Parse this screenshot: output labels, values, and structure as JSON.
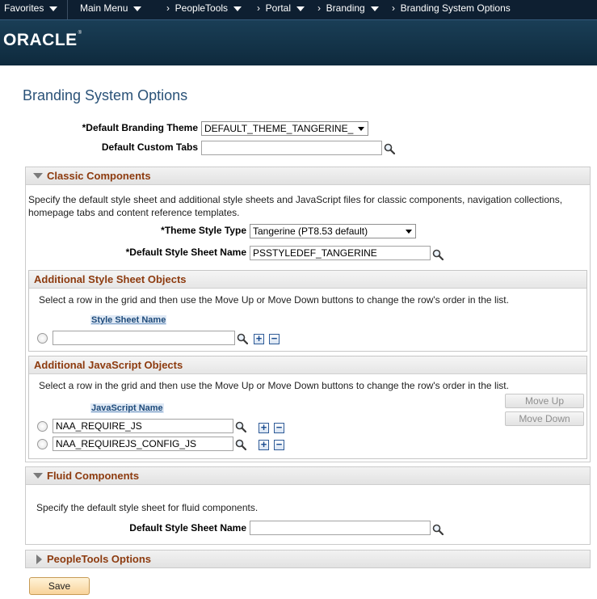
{
  "nav": {
    "favorites": "Favorites",
    "main_menu": "Main Menu",
    "crumbs": [
      "PeopleTools",
      "Portal",
      "Branding",
      "Branding System Options"
    ]
  },
  "logo": "ORACLE",
  "page_title": "Branding System Options",
  "fields": {
    "default_branding_theme_label": "*Default Branding Theme",
    "default_branding_theme_value": "DEFAULT_THEME_TANGERINE_",
    "default_custom_tabs_label": "Default Custom Tabs",
    "default_custom_tabs_value": ""
  },
  "classic": {
    "title": "Classic Components",
    "description_line1": "Specify the default style sheet and additional style sheets and JavaScript files for classic components, navigation collections,",
    "description_line2": "homepage tabs and content reference templates.",
    "theme_style_type_label": "*Theme Style Type",
    "theme_style_type_value": "Tangerine (PT8.53 default)",
    "default_style_sheet_label": "*Default Style Sheet Name",
    "default_style_sheet_value": "PSSTYLEDEF_TANGERINE",
    "style_sheet_objects": {
      "title": "Additional Style Sheet Objects",
      "instructions": "Select a row in the grid and then use the Move Up or Move Down buttons to change the row's order in the list.",
      "column": "Style Sheet Name",
      "rows": [
        ""
      ]
    },
    "js_objects": {
      "title": "Additional JavaScript Objects",
      "instructions": "Select a row in the grid and then use the Move Up or Move Down buttons to change the row's order in the list.",
      "column": "JavaScript Name",
      "rows": [
        "NAA_REQUIRE_JS",
        "NAA_REQUIREJS_CONFIG_JS"
      ],
      "move_up": "Move Up",
      "move_down": "Move Down"
    }
  },
  "fluid": {
    "title": "Fluid Components",
    "description": "Specify the default style sheet for fluid components.",
    "default_style_sheet_label": "Default Style Sheet Name",
    "default_style_sheet_value": ""
  },
  "peopletools_options": {
    "title": "PeopleTools Options"
  },
  "save_label": "Save",
  "icons": {
    "lookup": "magnifier-icon",
    "add": "plus-icon",
    "remove": "minus-icon",
    "dropdown": "triangle-down-icon"
  }
}
